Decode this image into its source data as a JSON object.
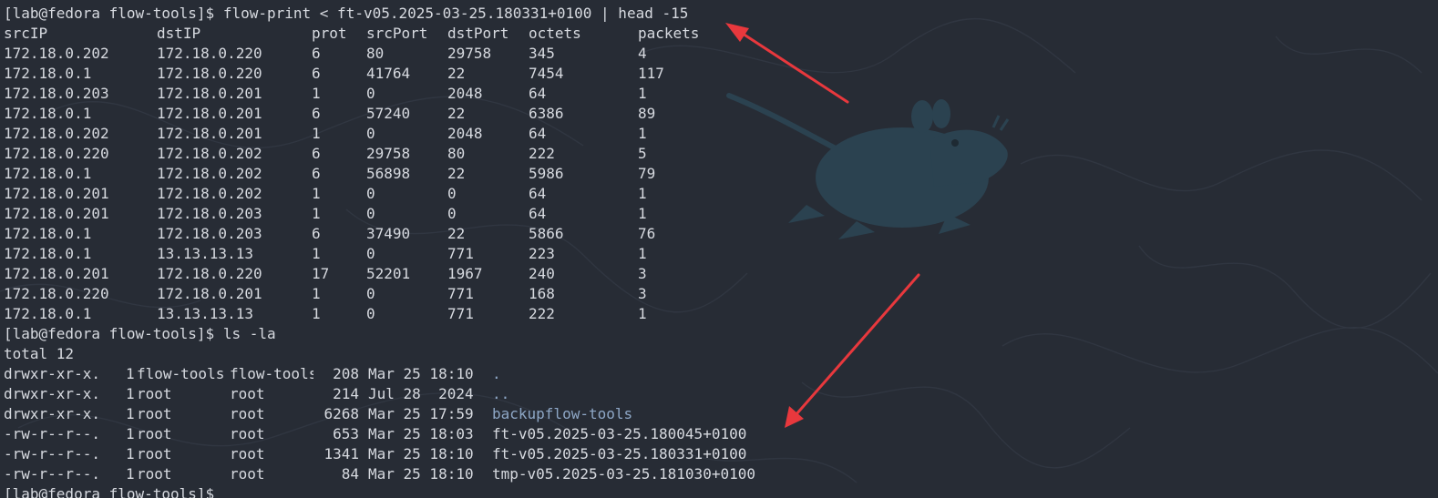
{
  "colors": {
    "background": "#272c35",
    "text": "#d7dae0",
    "directory": "#8ea7c6",
    "arrow": "#e8383d",
    "mascot": "#2b4250"
  },
  "icons": {
    "mascot": "xfce-mouse-icon",
    "arrows": "annotation-arrow-icon"
  },
  "terminal": {
    "prompt": "[lab@fedora flow-tools]$",
    "command1": "flow-print < ft-v05.2025-03-25.180331+0100 | head -15",
    "headers": [
      "srcIP",
      "dstIP",
      "prot",
      "srcPort",
      "dstPort",
      "octets",
      "packets"
    ],
    "flows": [
      [
        "172.18.0.202",
        "172.18.0.220",
        "6",
        "80",
        "29758",
        "345",
        "4"
      ],
      [
        "172.18.0.1",
        "172.18.0.220",
        "6",
        "41764",
        "22",
        "7454",
        "117"
      ],
      [
        "172.18.0.203",
        "172.18.0.201",
        "1",
        "0",
        "2048",
        "64",
        "1"
      ],
      [
        "172.18.0.1",
        "172.18.0.201",
        "6",
        "57240",
        "22",
        "6386",
        "89"
      ],
      [
        "172.18.0.202",
        "172.18.0.201",
        "1",
        "0",
        "2048",
        "64",
        "1"
      ],
      [
        "172.18.0.220",
        "172.18.0.202",
        "6",
        "29758",
        "80",
        "222",
        "5"
      ],
      [
        "172.18.0.1",
        "172.18.0.202",
        "6",
        "56898",
        "22",
        "5986",
        "79"
      ],
      [
        "172.18.0.201",
        "172.18.0.202",
        "1",
        "0",
        "0",
        "64",
        "1"
      ],
      [
        "172.18.0.201",
        "172.18.0.203",
        "1",
        "0",
        "0",
        "64",
        "1"
      ],
      [
        "172.18.0.1",
        "172.18.0.203",
        "6",
        "37490",
        "22",
        "5866",
        "76"
      ],
      [
        "172.18.0.1",
        "13.13.13.13",
        "1",
        "0",
        "771",
        "223",
        "1"
      ],
      [
        "172.18.0.201",
        "172.18.0.220",
        "17",
        "52201",
        "1967",
        "240",
        "3"
      ],
      [
        "172.18.0.220",
        "172.18.0.201",
        "1",
        "0",
        "771",
        "168",
        "3"
      ],
      [
        "172.18.0.1",
        "13.13.13.13",
        "1",
        "0",
        "771",
        "222",
        "1"
      ]
    ],
    "command2": "ls -la",
    "total": "total 12",
    "listing": [
      {
        "perm": "drwxr-xr-x.",
        "links": "1",
        "owner": "flow-tools",
        "group": "flow-tools",
        "size": "208",
        "date": "Mar 25 18:10",
        "name": ".",
        "dir": true
      },
      {
        "perm": "drwxr-xr-x.",
        "links": "1",
        "owner": "root",
        "group": "root",
        "size": "214",
        "date": "Jul 28  2024",
        "name": "..",
        "dir": true
      },
      {
        "perm": "drwxr-xr-x.",
        "links": "1",
        "owner": "root",
        "group": "root",
        "size": "6268",
        "date": "Mar 25 17:59",
        "name": "backupflow-tools",
        "dir": true
      },
      {
        "perm": "-rw-r--r--.",
        "links": "1",
        "owner": "root",
        "group": "root",
        "size": "653",
        "date": "Mar 25 18:03",
        "name": "ft-v05.2025-03-25.180045+0100",
        "dir": false
      },
      {
        "perm": "-rw-r--r--.",
        "links": "1",
        "owner": "root",
        "group": "root",
        "size": "1341",
        "date": "Mar 25 18:10",
        "name": "ft-v05.2025-03-25.180331+0100",
        "dir": false
      },
      {
        "perm": "-rw-r--r--.",
        "links": "1",
        "owner": "root",
        "group": "root",
        "size": "84",
        "date": "Mar 25 18:10",
        "name": "tmp-v05.2025-03-25.181030+0100",
        "dir": false
      }
    ]
  }
}
